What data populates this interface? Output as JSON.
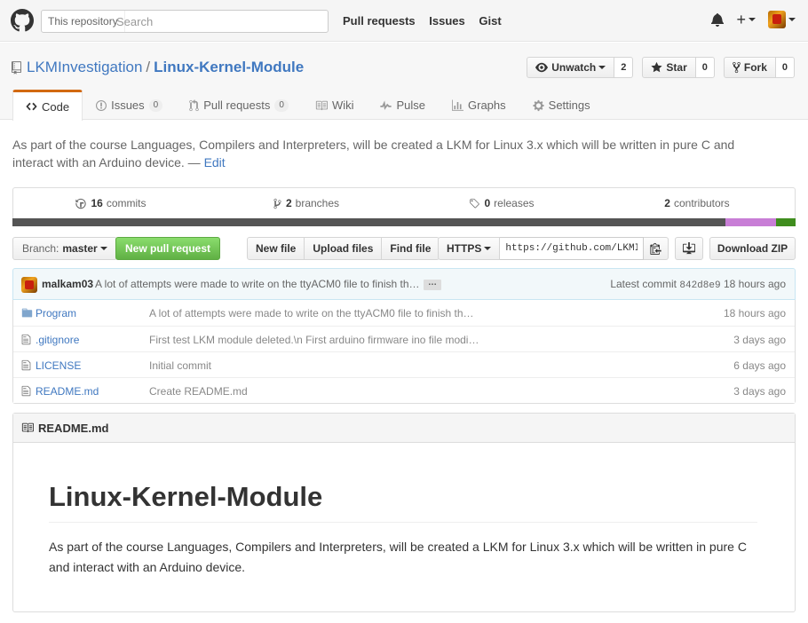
{
  "header": {
    "scope_label": "This repository",
    "search_placeholder": "Search",
    "nav": [
      "Pull requests",
      "Issues",
      "Gist"
    ]
  },
  "repo": {
    "owner": "LKMInvestigation",
    "separator": "/",
    "name": "Linux-Kernel-Module",
    "actions": {
      "watch_label": "Unwatch",
      "watch_count": "2",
      "star_label": "Star",
      "star_count": "0",
      "fork_label": "Fork",
      "fork_count": "0"
    },
    "tabs": [
      {
        "label": "Code",
        "counter": "",
        "selected": true,
        "icon": "code-icon"
      },
      {
        "label": "Issues",
        "counter": "0",
        "icon": "issue-icon"
      },
      {
        "label": "Pull requests",
        "counter": "0",
        "icon": "pull-request-icon"
      },
      {
        "label": "Wiki",
        "counter": "",
        "icon": "book-icon"
      },
      {
        "label": "Pulse",
        "counter": "",
        "icon": "pulse-icon"
      },
      {
        "label": "Graphs",
        "counter": "",
        "icon": "graph-icon"
      },
      {
        "label": "Settings",
        "counter": "",
        "icon": "gear-icon"
      }
    ],
    "description": "As part of the course Languages, Compilers and Interpreters, will be created a LKM for Linux 3.x which will be written in pure C and interact with an Arduino device.",
    "edit_sep": " — ",
    "edit_label": "Edit"
  },
  "summary": {
    "commits_count": "16",
    "commits_label": "commits",
    "branches_count": "2",
    "branches_label": "branches",
    "releases_count": "0",
    "releases_label": "releases",
    "contributors_count": "2",
    "contributors_label": "contributors",
    "languages": [
      {
        "color": "#555555",
        "percent": 91
      },
      {
        "color": "#c87ed6",
        "percent": 6.5
      },
      {
        "color": "#3f8d1e",
        "percent": 2.5
      }
    ]
  },
  "file_nav": {
    "branch_label": "Branch:",
    "branch_name": "master",
    "new_pr": "New pull request",
    "new_file": "New file",
    "upload_files": "Upload files",
    "find_file": "Find file",
    "protocol": "HTTPS",
    "clone_url": "https://github.com/LKMInv",
    "download_zip": "Download ZIP"
  },
  "latest_commit": {
    "author": "malkam03",
    "message": "A lot of attempts were made to write on the ttyACM0 file to finish th…",
    "ellipsis": "…",
    "label": "Latest commit",
    "sha": "842d8e9",
    "age": "18 hours ago"
  },
  "files": [
    {
      "name": "Program",
      "type": "folder",
      "message": "A lot of attempts were made to write on the ttyACM0 file to finish th…",
      "age": "18 hours ago"
    },
    {
      "name": ".gitignore",
      "type": "file",
      "message": "First test LKM module deleted.\\n First arduino firmware ino file modi…",
      "age": "3 days ago"
    },
    {
      "name": "LICENSE",
      "type": "file",
      "message": "Initial commit",
      "age": "6 days ago"
    },
    {
      "name": "README.md",
      "type": "file",
      "message": "Create README.md",
      "age": "3 days ago"
    }
  ],
  "readme": {
    "filename": "README.md",
    "heading": "Linux-Kernel-Module",
    "paragraph": "As part of the course Languages, Compilers and Interpreters, will be created a LKM for Linux 3.x which will be written in pure C and interact with an Arduino device."
  }
}
